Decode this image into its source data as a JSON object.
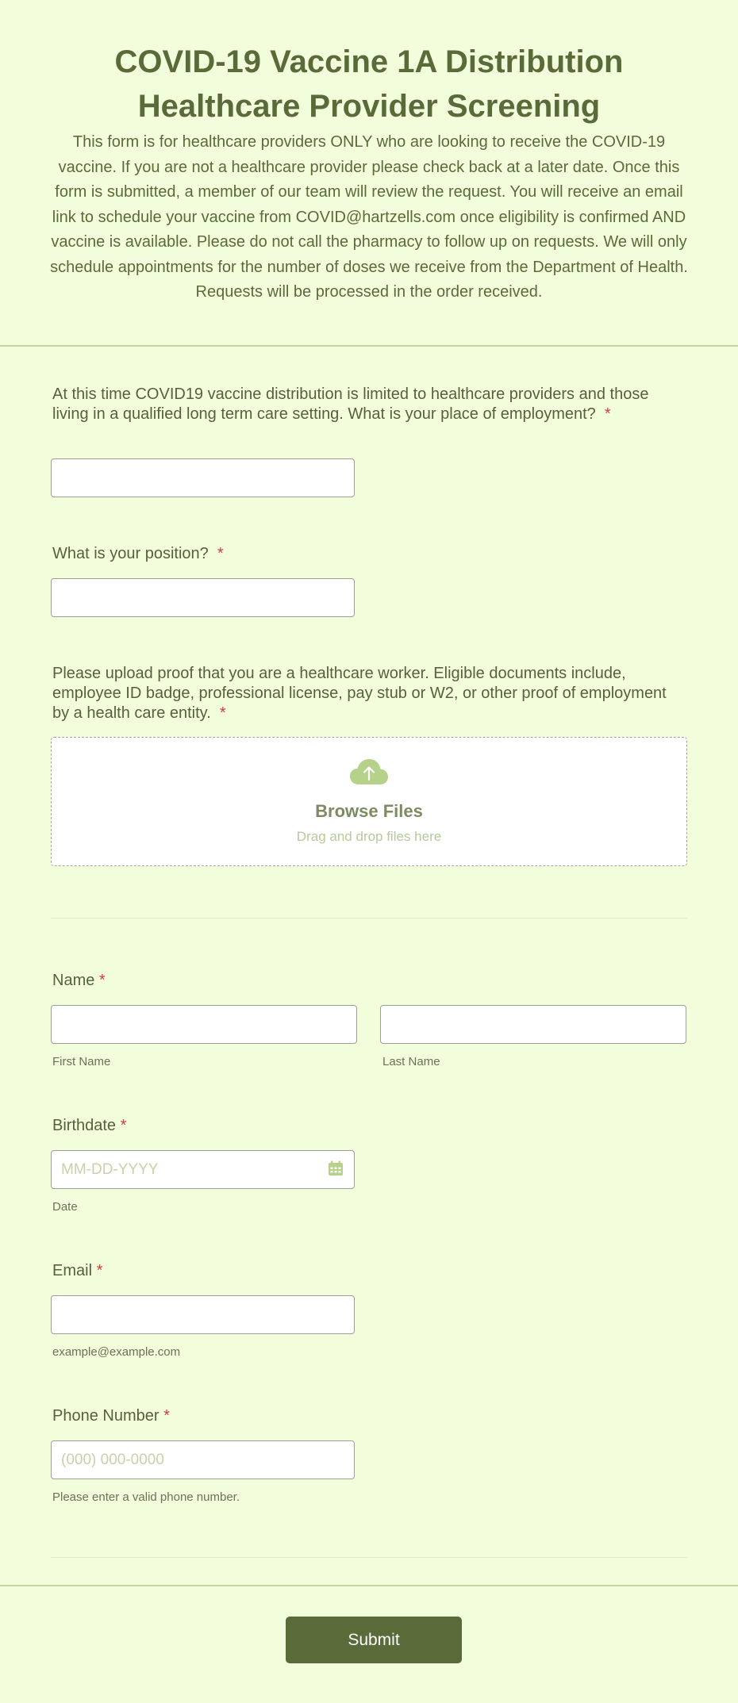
{
  "header": {
    "title": "COVID-19 Vaccine 1A Distribution Healthcare Provider Screening",
    "description": "This form is for healthcare providers ONLY who are looking to receive the COVID-19 vaccine. If you are not a healthcare provider please check back at a later date. Once this form is submitted, a member of our team will review the request. You will receive an email link to schedule your vaccine from COVID@hartzells.com once eligibility is confirmed AND vaccine is available. Please do not call the pharmacy to follow up on requests. We will only schedule appointments for the number of doses we receive from the Department of Health. Requests will be processed in the order received."
  },
  "required_mark": "*",
  "fields": {
    "employment": {
      "label": "At this time COVID19 vaccine distribution is limited to healthcare providers and those living in a qualified long term care setting. What is your place of employment?",
      "value": ""
    },
    "position": {
      "label": "What is your position?",
      "value": ""
    },
    "proof": {
      "label": "Please upload proof that you are a healthcare worker. Eligible documents include, employee ID badge, professional license, pay stub or W2, or other proof of employment by a health care entity.",
      "browse_label": "Browse Files",
      "drag_label": "Drag and drop files here",
      "icon": "cloud-upload-icon"
    },
    "name": {
      "label": "Name",
      "first_sublabel": "First Name",
      "last_sublabel": "Last Name",
      "first_value": "",
      "last_value": ""
    },
    "birthdate": {
      "label": "Birthdate",
      "placeholder": "MM-DD-YYYY",
      "sublabel": "Date",
      "icon": "calendar-icon"
    },
    "email": {
      "label": "Email",
      "sublabel": "example@example.com",
      "value": ""
    },
    "phone": {
      "label": "Phone Number",
      "placeholder": "(000) 000-0000",
      "sublabel": "Please enter a valid phone number."
    }
  },
  "submit": {
    "label": "Submit"
  },
  "colors": {
    "background": "#f2fddc",
    "text": "#55613b",
    "accent": "#5a6a38",
    "required": "#d0403a",
    "icon": "#b5d18a"
  }
}
